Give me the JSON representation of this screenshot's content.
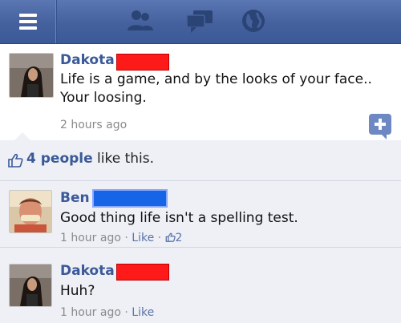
{
  "post": {
    "author": "Dakota",
    "text_line1": "Life is a game, and by the looks of your face..",
    "text_line2": "Your loosing.",
    "time": "2 hours ago"
  },
  "likes": {
    "count": "4 people",
    "suffix": " like this."
  },
  "comments": [
    {
      "author": "Ben",
      "text": "Good thing life isn't a spelling test.",
      "time": "1 hour ago",
      "sep1": " · ",
      "like": "Like",
      "sep2": " · ",
      "like_count": "2"
    },
    {
      "author": "Dakota",
      "text": "Huh?",
      "time": "1 hour ago",
      "sep1": " · ",
      "like": "Like"
    }
  ],
  "icons": [
    "menu-icon",
    "friends-icon",
    "messages-icon",
    "globe-icon",
    "plus-icon",
    "thumbs-up-icon"
  ],
  "colors": {
    "brand": "#3b5998",
    "redaction_red": "#ff1a1a",
    "redaction_blue": "#1565e6"
  }
}
